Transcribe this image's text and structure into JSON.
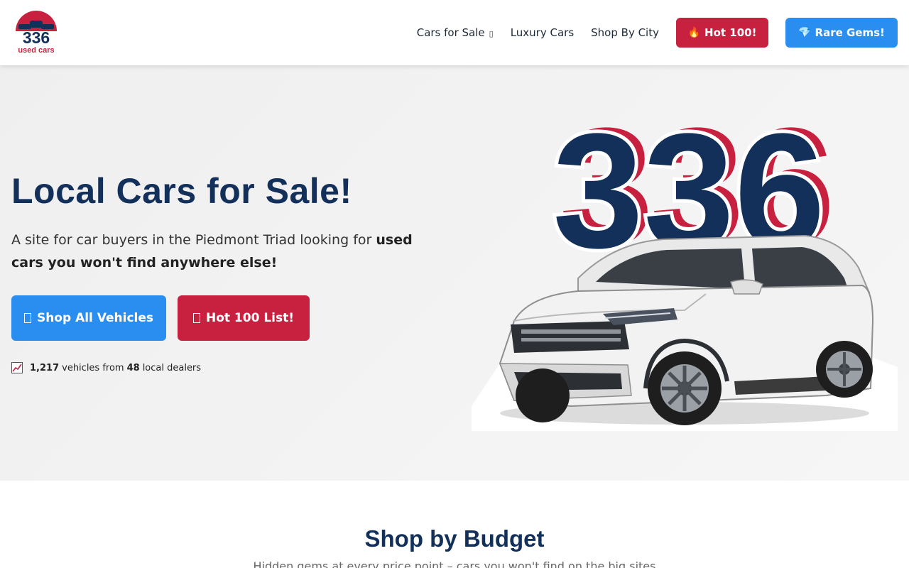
{
  "brand": {
    "logo_number": "336",
    "logo_text": "used cars"
  },
  "nav": {
    "items": [
      {
        "label": "Cars for Sale",
        "has_dropdown": true
      },
      {
        "label": "Luxury Cars"
      },
      {
        "label": "Shop By City"
      }
    ],
    "hot_button": {
      "emoji": "🔥",
      "label": "Hot 100!"
    },
    "rare_button": {
      "emoji": "💎",
      "label": "Rare Gems!"
    }
  },
  "hero": {
    "title": "Local Cars for Sale!",
    "subtitle_prefix": "A site for car buyers in the Piedmont Triad looking for ",
    "subtitle_bold": "used cars you won't find anywhere else!",
    "shop_button": "Shop All Vehicles",
    "hot_list_button": "Hot 100 List!",
    "stats": {
      "vehicles": "1,217",
      "vehicles_text": "vehicles from",
      "dealers": "48",
      "dealers_text": "local dealers"
    },
    "art_number": "336"
  },
  "budget": {
    "title": "Shop by Budget",
    "subtitle": "Hidden gems at every price point – cars you won't find on the big sites"
  },
  "colors": {
    "navy": "#13305a",
    "red": "#c8203f",
    "blue": "#2a8ef0"
  }
}
